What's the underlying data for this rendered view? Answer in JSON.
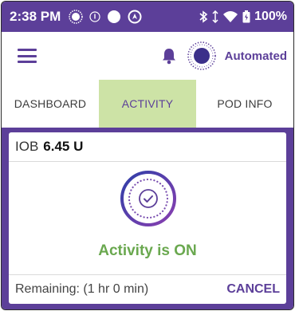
{
  "status_bar": {
    "time": "2:38 PM",
    "battery_percent": "100%",
    "icons": [
      "pod-icon",
      "info-icon",
      "circle-icon",
      "compass-icon",
      "bluetooth-icon",
      "signal-icon",
      "wifi-icon",
      "battery-icon"
    ]
  },
  "header": {
    "menu_icon": "menu-icon",
    "bell_icon": "bell-icon",
    "pod_status_icon": "pod-status-icon",
    "mode_label": "Automated"
  },
  "tabs": [
    {
      "label": "DASHBOARD",
      "active": false
    },
    {
      "label": "ACTIVITY",
      "active": true
    },
    {
      "label": "POD INFO",
      "active": false
    }
  ],
  "card": {
    "iob_label": "IOB",
    "iob_value": "6.45 U",
    "activity_icon": "activity-check-icon",
    "activity_status": "Activity is ON",
    "remaining_text": "Remaining: (1 hr 0 min)",
    "cancel_label": "CANCEL"
  },
  "colors": {
    "brand_purple": "#5c3f99",
    "active_tab_bg": "#cde3a6",
    "activity_green": "#6aa84f"
  }
}
